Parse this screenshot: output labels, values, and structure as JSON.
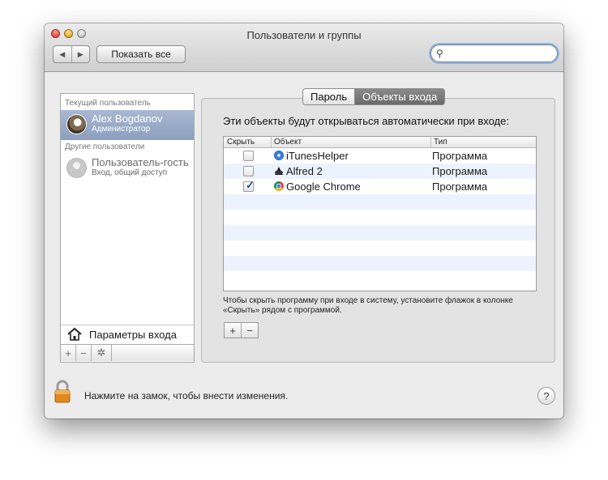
{
  "window": {
    "title": "Пользователи и группы"
  },
  "toolbar": {
    "back_icon": "◀",
    "forward_icon": "▶",
    "show_all_label": "Показать все",
    "search_placeholder": ""
  },
  "sidebar": {
    "current_header": "Текущий пользователь",
    "current_user": {
      "name": "Alex Bogdanov",
      "role": "Администратор"
    },
    "other_header": "Другие пользователи",
    "other_users": [
      {
        "name": "Пользователь-гость",
        "role": "Вход, общий доступ"
      }
    ],
    "login_options_label": "Параметры входа",
    "add_label": "+",
    "remove_label": "−",
    "gear_label": "✲"
  },
  "tabs": [
    {
      "label": "Пароль",
      "active": false
    },
    {
      "label": "Объекты входа",
      "active": true
    }
  ],
  "login_items": {
    "heading": "Эти объекты будут открываться автоматически при входе:",
    "columns": [
      "Скрыть",
      "Объект",
      "Тип"
    ],
    "rows": [
      {
        "hide": false,
        "name": "iTunesHelper",
        "type": "Программа",
        "icon": "itunes-icon"
      },
      {
        "hide": false,
        "name": "Alfred 2",
        "type": "Программа",
        "icon": "alfred-icon"
      },
      {
        "hide": true,
        "name": "Google Chrome",
        "type": "Программа",
        "icon": "chrome-icon"
      }
    ],
    "hint": "Чтобы скрыть программу при входе в систему, установите флажок в колонке «Скрыть» рядом с программой.",
    "add_label": "+",
    "remove_label": "−"
  },
  "footer": {
    "lock_text": "Нажмите на замок, чтобы внести изменения.",
    "help_label": "?"
  },
  "colors": {
    "selection": "#8c9fbf",
    "active_tab": "#6a6a6a",
    "lock": "#e08a1e"
  }
}
